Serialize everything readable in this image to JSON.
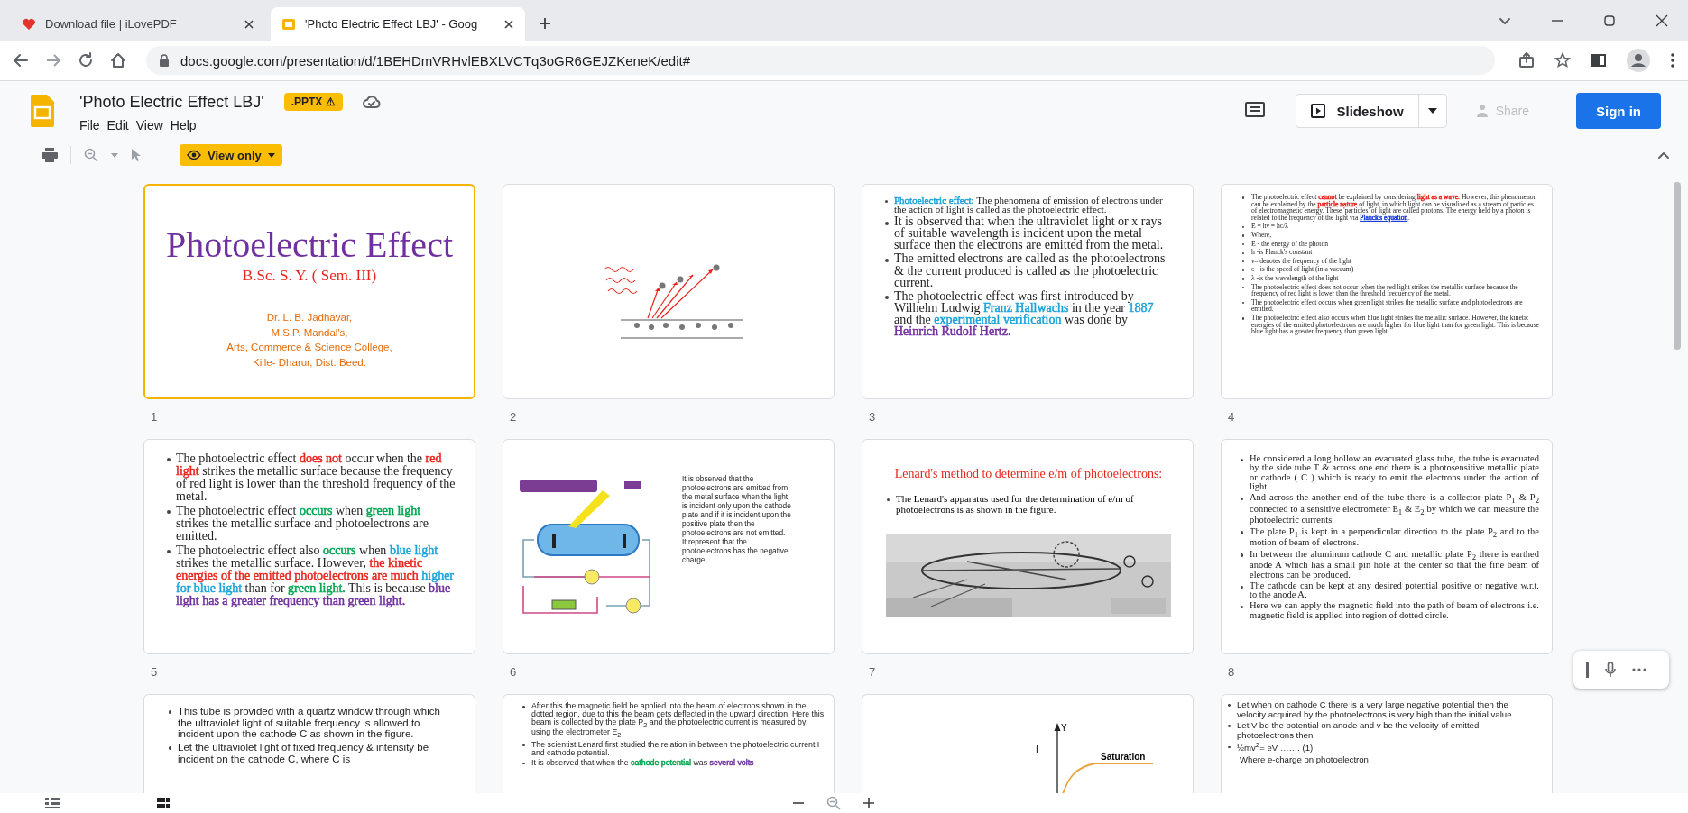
{
  "browser": {
    "tabs": [
      {
        "title": "Download file | iLovePDF",
        "selected": false
      },
      {
        "title": "'Photo Electric Effect LBJ' - Goog",
        "selected": true
      }
    ],
    "address": "docs.google.com/presentation/d/1BEHDmVRHvlEBXLVCTq3oGR6GEJZKeneK/edit#"
  },
  "doc": {
    "title": "'Photo Electric Effect LBJ'",
    "badge": ".PPTX ⚠",
    "menu": [
      "File",
      "Edit",
      "View",
      "Help"
    ],
    "slideshow_button": "Slideshow",
    "share_button": {
      "label": "Share",
      "disabled": true
    },
    "sign_in_button": "Sign in"
  },
  "toolbar": {
    "view_mode": "View only"
  },
  "slides": [
    {
      "number": "1",
      "selected": true,
      "kind": "title",
      "title": "Photoelectric Effect",
      "subtitle": "B.Sc. S. Y. ( Sem. III)",
      "authors": [
        "Dr. L. B. Jadhavar,",
        "M.S.P. Mandal's,",
        "Arts, Commerce & Science College,",
        "Kille- Dharur, Dist. Beed."
      ]
    },
    {
      "number": "2",
      "selected": false,
      "kind": "drawing"
    },
    {
      "number": "3",
      "selected": false,
      "kind": "bullets",
      "bullets": [
        [
          {
            "text": "Photoelectric effect:",
            "color": "#1aa3d9"
          },
          " The phenomena of emission of electrons under the action of light is called as the photoelectric effect."
        ],
        "It is observed that when the ultraviolet light or x rays of suitable wavelength is incident upon the metal surface then the electrons are emitted from the metal.",
        "The emitted electrons are called as the photoelectrons & the current produced is called as the photoelectric current.",
        [
          "The photoelectric effect was first introduced by Wilhelm Ludwig ",
          {
            "text": "Franz Hallwachs",
            "color": "#1aa3d9"
          },
          " in the year ",
          {
            "text": "1887",
            "color": "#1aa3d9"
          },
          " and the ",
          {
            "text": "experimental verification",
            "color": "#1aa3d9"
          },
          " was done by ",
          {
            "text": "Heinrich Rudolf Hertz.",
            "color": "#7030a0"
          }
        ]
      ]
    },
    {
      "number": "4",
      "selected": false,
      "kind": "bullets",
      "bullets": [
        [
          "The photoelectric effect ",
          {
            "text": "cannot",
            "color": "#e8251c"
          },
          " be explained by considering ",
          {
            "text": "light as a wave.",
            "color": "#e8251c"
          },
          " However, this phenomenon can be explained by the ",
          {
            "text": "particle nature",
            "color": "#e8251c"
          },
          " of light, in which light can be visualized as a stream of particles of electromagnetic energy. These 'particles' of light are called photons. The energy held by a photon is related to the frequency of the light via ",
          {
            "text": "Planck's equation",
            "color": "#1f3fd6",
            "kind": "link"
          },
          "."
        ],
        "E = hν = hc/λ",
        "Where,",
        "E - the energy of the photon",
        "h -is Planck's constant",
        "ν– denotes the frequency of the light",
        "c - is the speed of light (in a vacuum)",
        "λ -is the wavelength of the light",
        "The photoelectric effect does not occur when the red light strikes the metallic surface because the frequency of red light is lower than the threshold frequency of the metal.",
        "The photoelectric effect occurs when green light strikes the metallic surface and photoelectrons are emitted.",
        "The photoelectric effect also occurs when blue light strikes the metallic surface. However, the kinetic energies of the emitted photoelectrons are much higher for blue light than for green light. This is because blue light has a greater frequency than green light."
      ]
    },
    {
      "number": "5",
      "selected": false,
      "kind": "bullets",
      "bullets": [
        [
          "The photoelectric effect ",
          {
            "text": "does not",
            "color": "#e8251c"
          },
          " occur when the ",
          {
            "text": "red light",
            "color": "#e8251c"
          },
          " strikes the metallic surface because the frequency of red light is lower than the threshold frequency of the metal."
        ],
        [
          "The photoelectric effect ",
          {
            "text": "occurs",
            "color": "#00a651"
          },
          " when ",
          {
            "text": "green light",
            "color": "#00a651"
          },
          " strikes the metallic surface and photoelectrons are emitted."
        ],
        [
          "The photoelectric effect also ",
          {
            "text": "occurs",
            "color": "#00a651"
          },
          " when ",
          {
            "text": "blue light",
            "color": "#1aa3d9"
          },
          " strikes the metallic surface. However, ",
          {
            "text": "the kinetic energies of the emitted photoelectrons are much ",
            "color": "#e8251c"
          },
          {
            "text": "higher for blue light",
            "color": "#1aa3d9"
          },
          " than for ",
          {
            "text": "green light.",
            "color": "#00a651"
          },
          " This is because ",
          {
            "text": "blue light has a greater frequency than green light.",
            "color": "#7030a0"
          }
        ]
      ]
    },
    {
      "number": "6",
      "selected": false,
      "kind": "image-text",
      "paragraphs": [
        "It is observed that the photoelectrons are emitted from the metal surface when the light is incident only upon the cathode plate and if it is incident upon the positive plate then the photoelectrons are not emitted.",
        "It represent that the photoelectrons has the negative charge."
      ]
    },
    {
      "number": "7",
      "selected": false,
      "kind": "heading-picture",
      "heading": "Lenard's method to determine e/m of photoelectrons:",
      "bullets": [
        "The Lenard's apparatus used for the determination of e/m of photoelectrons is as shown in the figure."
      ]
    },
    {
      "number": "8",
      "selected": false,
      "kind": "bullets",
      "bullets": [
        "He considered a long hollow an evacuated glass tube, the tube is evacuated by the side tube T & across one end there is a photosensitive metallic plate or cathode ( C ) which is ready to emit the electrons under the action of light.",
        "And across the another end of the tube there is a collector plate P$_{1}$ & P$_{2}$ connected to a sensitive electrometer E$_{1}$ & E$_{2}$ by which we can measure the photoelectric currents.",
        "The plate P$_{1}$ is kept in a perpendicular direction to the plate P$_{2}$ and to the motion of beam of electrons.",
        "In between the aluminum cathode C and metallic plate P$_{2}$ there is earthed anode A which has a small pin hole at the center so that the fine beam of electrons can be produced.",
        "The cathode can be kept at any desired potential positive or negative w.r.t. to the anode A.",
        "Here we can apply the magnetic field into the path of beam of electrons i.e. magnetic field is applied into region of dotted circle."
      ]
    },
    {
      "selected": false,
      "kind": "bullets",
      "bullets": [
        "This tube is provided with a quartz window through which the ultraviolet light of suitable frequency is allowed to incident upon the cathode C as shown in the figure.",
        "Let the ultraviolet light of fixed frequency & intensity be incident on the cathode C, where C is"
      ]
    },
    {
      "selected": false,
      "kind": "bullets",
      "bullets": [
        "After this the magnetic field be applied into the beam of electrons shown in the dotted region, due to this the beam gets deflected in the upward direction. Here this beam is collected by the plate P$_{2}$ and the photoelectric current is measured by using the electrometer E$_{2}$",
        "The scientist Lenard first studied the relation in between the photoelectric current I and cathode potential.",
        [
          "It is observed that when the ",
          {
            "text": "cathode potential",
            "color": "#00a651"
          },
          " was ",
          {
            "text": "several volts",
            "color": "#7030a0"
          }
        ]
      ]
    },
    {
      "selected": false,
      "kind": "graph",
      "axis_label": "Y",
      "y_label": "I",
      "curve_label": "Saturation"
    },
    {
      "selected": false,
      "kind": "bullets",
      "bullets": [
        "Let when on cathode C there is a very large negative potential then the velocity acquired by the photoelectrons is very high than the initial value.",
        "Let V be the potential on anode  and v be the velocity of emitted photoelectrons then",
        "½mv$^{2}$= eV  ……. (1)"
      ],
      "note": "Where e-charge on photoelectron"
    }
  ]
}
